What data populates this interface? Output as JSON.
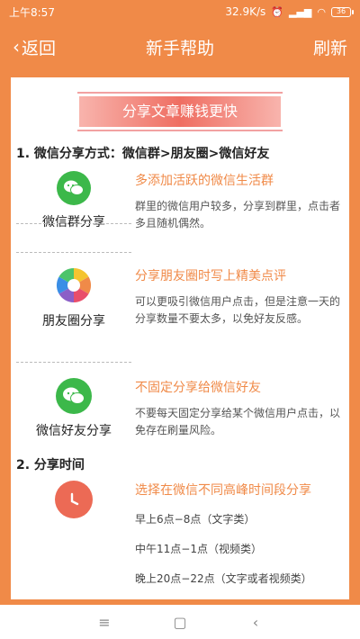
{
  "status": {
    "time": "上午8:57",
    "speed": "32.9K/s",
    "battery": "36"
  },
  "nav": {
    "back_label": "返回",
    "title": "新手帮助",
    "refresh_label": "刷新"
  },
  "banner": "分享文章赚钱更快",
  "section1": "1. 微信分享方式：微信群>朋友圈>微信好友",
  "shares": [
    {
      "label": "微信群分享",
      "icon": "wechat-group-icon",
      "title": "多添加活跃的微信生活群",
      "desc": "群里的微信用户较多，分享到群里，点击者多且随机偶然。"
    },
    {
      "label": "朋友圈分享",
      "icon": "moments-icon",
      "title": "分享朋友圈时写上精美点评",
      "desc": "可以更吸引微信用户点击，但是注意一天的分享数量不要太多，以免好友反感。"
    },
    {
      "label": "微信好友分享",
      "icon": "wechat-icon",
      "title": "不固定分享给微信好友",
      "desc": "不要每天固定分享给某个微信用户点击，以免存在刷量风险。"
    }
  ],
  "section2": "2. 分享时间",
  "time_block": {
    "icon": "clock-icon",
    "title": "选择在微信不同高峰时间段分享",
    "lines": [
      "早上6点−8点（文字类）",
      "中午11点−1点（视频类）",
      "晚上20点−22点（文字或者视频类）"
    ]
  },
  "colors": {
    "accent": "#f08a48",
    "wechat_green": "#3cb84a",
    "clock_red": "#ec6a55"
  }
}
